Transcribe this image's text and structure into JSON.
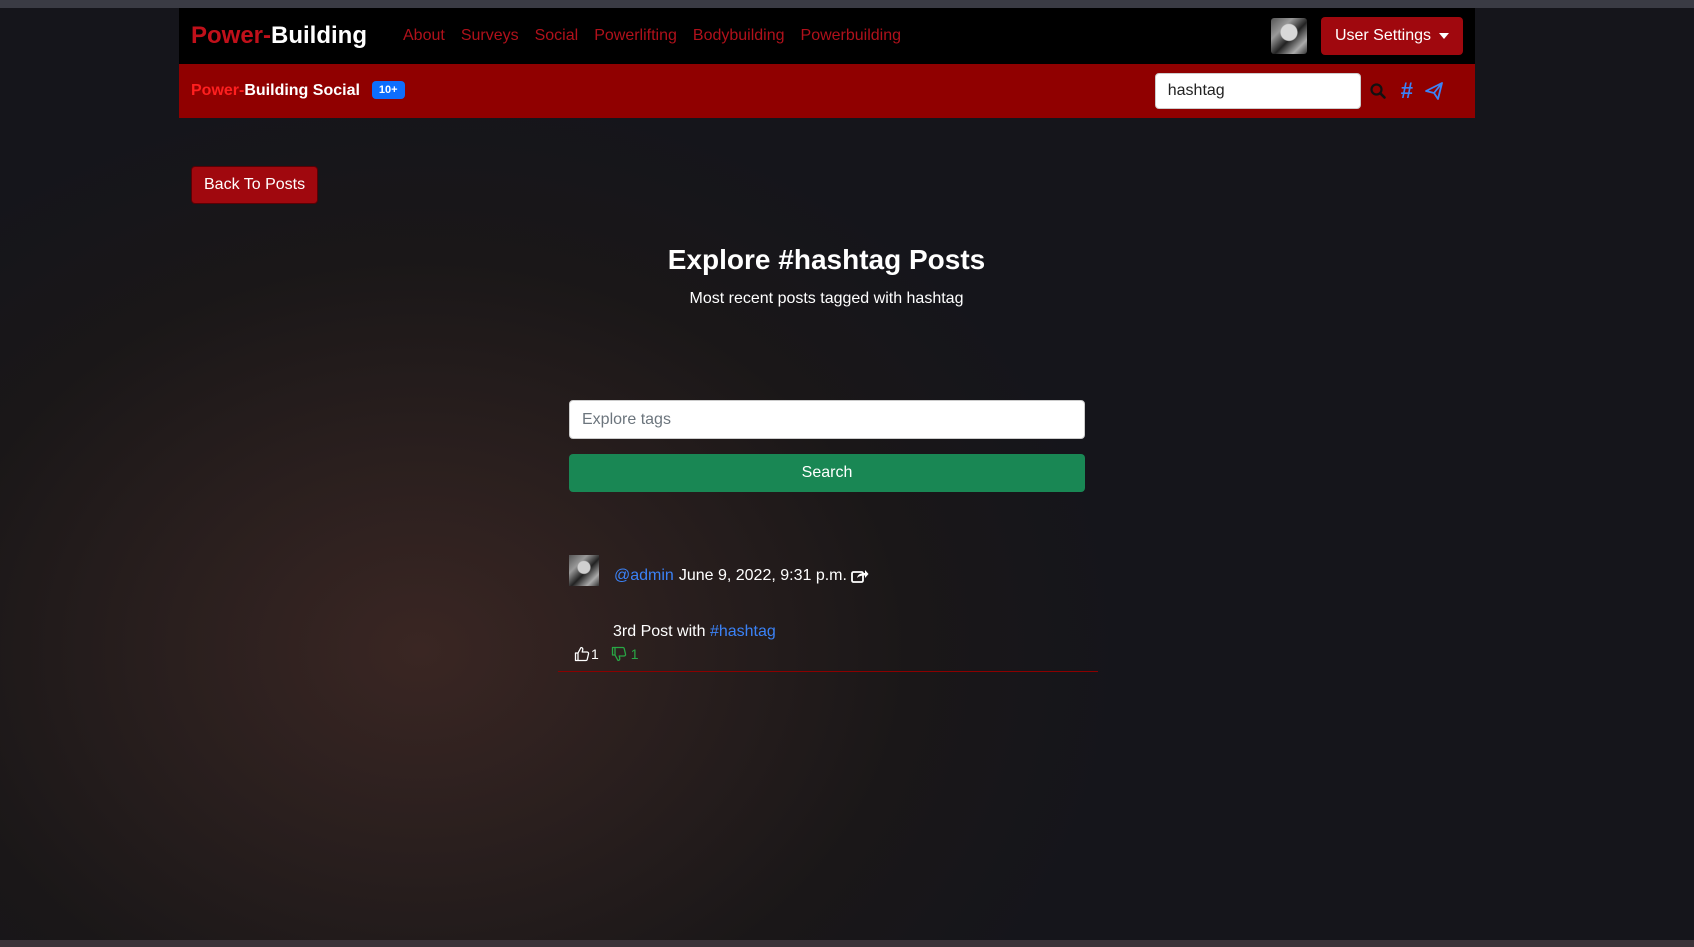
{
  "navbar": {
    "brand_red": "Power-",
    "brand_white": "Building",
    "links": [
      "About",
      "Surveys",
      "Social",
      "Powerlifting",
      "Bodybuilding",
      "Powerbuilding"
    ],
    "user_settings_label": "User Settings"
  },
  "subbar": {
    "brand_red": "Power-",
    "brand_white": "Building Social",
    "badge": "10+",
    "search_value": "hashtag",
    "hash_symbol": "#"
  },
  "page": {
    "back_label": "Back To Posts",
    "title": "Explore #hashtag Posts",
    "subtitle": "Most recent posts tagged with hashtag",
    "explore_placeholder": "Explore tags",
    "search_label": "Search"
  },
  "post": {
    "handle": "@admin",
    "timestamp": "June 9, 2022, 9:31 p.m.",
    "text_prefix": "3rd Post with ",
    "tag": "#hashtag",
    "likes": "1",
    "dislikes": "1"
  },
  "colors": {
    "brand_red": "#b0111b",
    "subbar_bg": "#900000",
    "link_blue": "#3b82f6",
    "search_green": "#198754"
  },
  "icons": [
    "user-avatar",
    "caret-down-icon",
    "search-icon",
    "hash-icon",
    "send-icon",
    "share-icon",
    "thumbs-up-icon",
    "thumbs-down-icon"
  ]
}
